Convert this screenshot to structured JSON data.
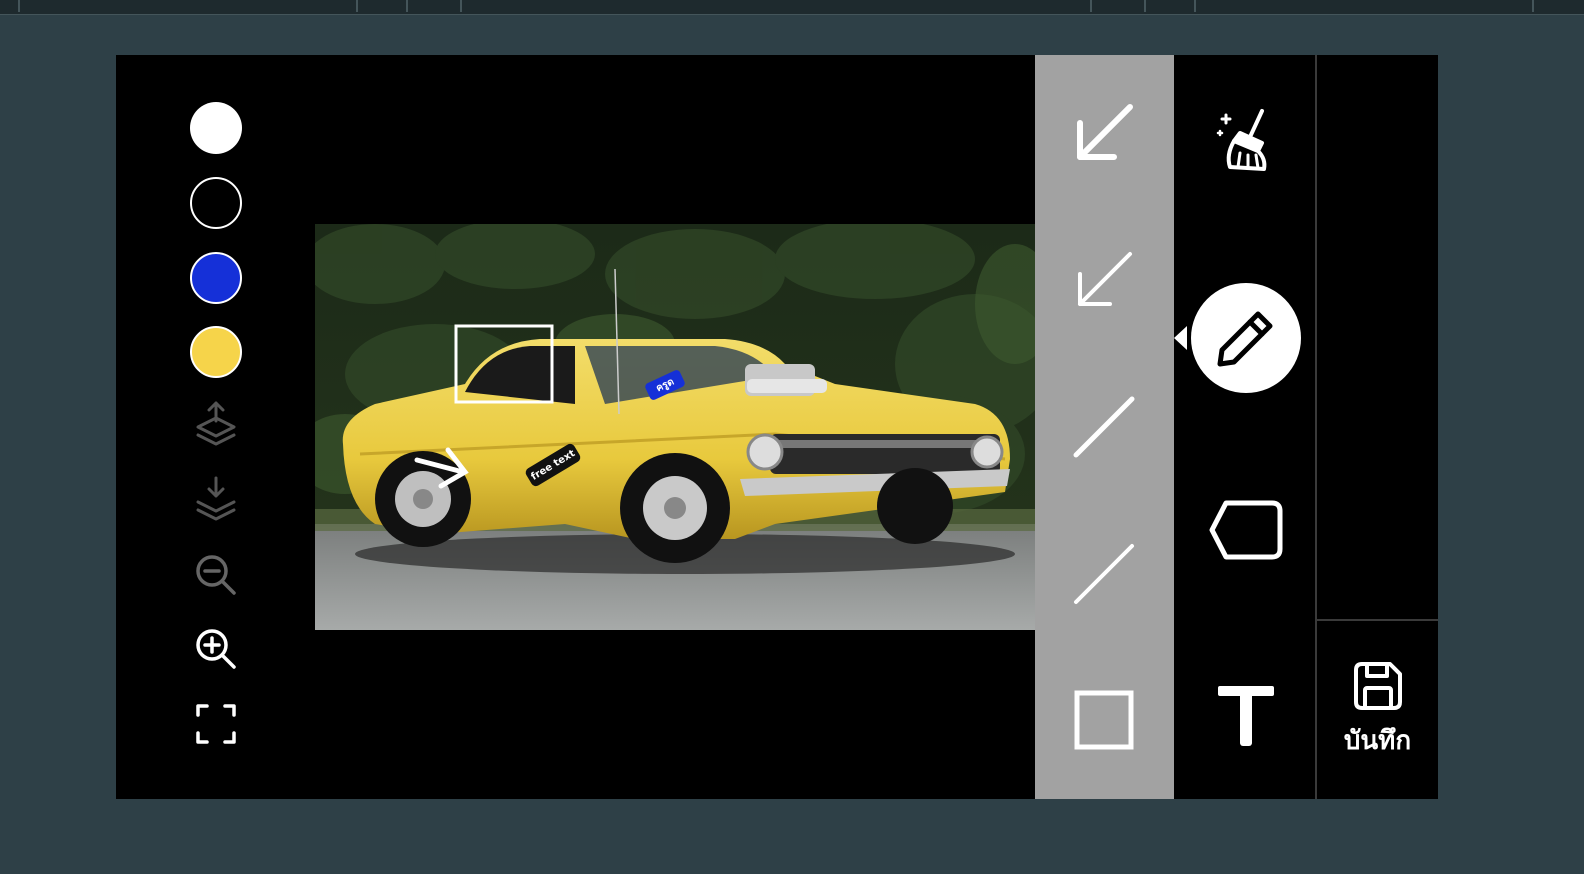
{
  "palette": {
    "colors": [
      {
        "name": "white",
        "hex": "#ffffff"
      },
      {
        "name": "black",
        "hex": "#000000"
      },
      {
        "name": "blue",
        "hex": "#1530d8"
      },
      {
        "name": "yellow",
        "hex": "#f6d44a"
      }
    ]
  },
  "left_tools": [
    {
      "name": "bring-forward-icon",
      "enabled": false
    },
    {
      "name": "send-backward-icon",
      "enabled": false
    },
    {
      "name": "zoom-out-icon",
      "enabled": false
    },
    {
      "name": "zoom-in-icon",
      "enabled": true
    },
    {
      "name": "fit-screen-icon",
      "enabled": true
    }
  ],
  "annotations": {
    "free_text_label": "free text",
    "blue_tag_label": "ครูด"
  },
  "shape_panel": {
    "items": [
      "arrow-down-left-icon",
      "thin-arrow-down-left-icon",
      "line-icon",
      "thin-line-icon",
      "rectangle-icon"
    ],
    "background": "#a2a2a2"
  },
  "tools": {
    "items": [
      "clean-brush-icon",
      "pencil-icon",
      "tag-shape-icon",
      "text-tool-icon"
    ],
    "active": "pencil-icon"
  },
  "save": {
    "label": "บันทึก"
  }
}
